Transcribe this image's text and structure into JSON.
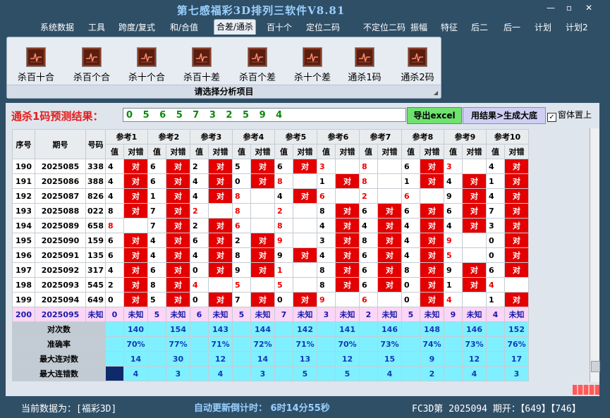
{
  "window": {
    "title": "第七感福彩3D排列三软件V8.81",
    "minimize": "—",
    "maximize": "▫",
    "close": "✕"
  },
  "menu": [
    "系统数据",
    "工具",
    "跨度/复式",
    "和/合值",
    "合差/通杀",
    "百十个",
    "定位二码",
    "不定位二码",
    "振幅",
    "特征",
    "后二",
    "后一",
    "计划",
    "计划2"
  ],
  "menu_active_index": 4,
  "ribbon": {
    "buttons": [
      "杀百十合",
      "杀百个合",
      "杀十个合",
      "杀百十差",
      "杀百个差",
      "杀十个差",
      "通杀1码",
      "通杀2码"
    ],
    "caption": "请选择分析项目",
    "corner": "◢"
  },
  "prediction": {
    "label": "通杀1码预测结果：",
    "value": "0 5 6 5 7 3 2 5 9 4",
    "export_button": "导出excel",
    "generate_button": "用结果>生成大底",
    "topmost_label": "窗体置上",
    "topmost_checked": "✓"
  },
  "table": {
    "fixed_headers": [
      "序号",
      "期号",
      "号码"
    ],
    "ref_labels": [
      "参考1",
      "参考2",
      "参考3",
      "参考4",
      "参考5",
      "参考6",
      "参考7",
      "参考8",
      "参考9",
      "参考10"
    ],
    "sub_value": "值",
    "sub_check": "对错",
    "hit_text": "对",
    "rows": [
      {
        "seq": "190",
        "period": "2025085",
        "num": "338",
        "vals": [
          "4",
          "6",
          "2",
          "5",
          "6",
          "3",
          "8",
          "6",
          "3",
          "4"
        ],
        "red": [
          0,
          0,
          0,
          0,
          0,
          1,
          1,
          0,
          1,
          0
        ],
        "hit": [
          1,
          1,
          1,
          1,
          1,
          0,
          0,
          1,
          0,
          1
        ]
      },
      {
        "seq": "191",
        "period": "2025086",
        "num": "388",
        "vals": [
          "4",
          "6",
          "4",
          "0",
          "8",
          "1",
          "8",
          "1",
          "4",
          "1"
        ],
        "red": [
          0,
          0,
          0,
          0,
          1,
          0,
          1,
          0,
          0,
          0
        ],
        "hit": [
          1,
          1,
          1,
          1,
          0,
          1,
          0,
          1,
          1,
          1
        ]
      },
      {
        "seq": "192",
        "period": "2025087",
        "num": "826",
        "vals": [
          "4",
          "1",
          "4",
          "8",
          "4",
          "6",
          "2",
          "6",
          "9",
          "4"
        ],
        "red": [
          0,
          0,
          0,
          1,
          0,
          1,
          1,
          1,
          0,
          0
        ],
        "hit": [
          1,
          1,
          1,
          0,
          1,
          0,
          0,
          0,
          1,
          1
        ]
      },
      {
        "seq": "193",
        "period": "2025088",
        "num": "022",
        "vals": [
          "8",
          "7",
          "2",
          "8",
          "2",
          "8",
          "6",
          "6",
          "6",
          "7"
        ],
        "red": [
          0,
          0,
          1,
          1,
          1,
          0,
          0,
          0,
          0,
          0
        ],
        "hit": [
          1,
          1,
          0,
          0,
          0,
          1,
          1,
          1,
          1,
          1
        ]
      },
      {
        "seq": "194",
        "period": "2025089",
        "num": "658",
        "vals": [
          "8",
          "7",
          "2",
          "6",
          "8",
          "4",
          "4",
          "4",
          "4",
          "3"
        ],
        "red": [
          1,
          0,
          0,
          1,
          1,
          0,
          0,
          0,
          0,
          0
        ],
        "hit": [
          0,
          1,
          1,
          0,
          0,
          1,
          1,
          1,
          1,
          1
        ]
      },
      {
        "seq": "195",
        "period": "2025090",
        "num": "159",
        "vals": [
          "6",
          "4",
          "6",
          "2",
          "9",
          "3",
          "8",
          "4",
          "9",
          "0"
        ],
        "red": [
          0,
          0,
          0,
          0,
          1,
          0,
          0,
          0,
          1,
          0
        ],
        "hit": [
          1,
          1,
          1,
          1,
          0,
          1,
          1,
          1,
          0,
          1
        ]
      },
      {
        "seq": "196",
        "period": "2025091",
        "num": "135",
        "vals": [
          "6",
          "4",
          "4",
          "8",
          "9",
          "4",
          "6",
          "4",
          "5",
          "0"
        ],
        "red": [
          0,
          0,
          0,
          0,
          0,
          0,
          0,
          0,
          1,
          0
        ],
        "hit": [
          1,
          1,
          1,
          1,
          1,
          1,
          1,
          1,
          0,
          1
        ]
      },
      {
        "seq": "197",
        "period": "2025092",
        "num": "317",
        "vals": [
          "4",
          "6",
          "0",
          "9",
          "1",
          "8",
          "6",
          "8",
          "9",
          "6"
        ],
        "red": [
          0,
          0,
          0,
          0,
          1,
          0,
          0,
          0,
          0,
          0
        ],
        "hit": [
          1,
          1,
          1,
          1,
          0,
          1,
          1,
          1,
          1,
          1
        ]
      },
      {
        "seq": "198",
        "period": "2025093",
        "num": "545",
        "vals": [
          "2",
          "8",
          "4",
          "5",
          "5",
          "8",
          "6",
          "0",
          "1",
          "4"
        ],
        "red": [
          0,
          0,
          1,
          1,
          1,
          0,
          0,
          0,
          0,
          1
        ],
        "hit": [
          1,
          1,
          0,
          0,
          0,
          1,
          1,
          1,
          1,
          0
        ]
      },
      {
        "seq": "199",
        "period": "2025094",
        "num": "649",
        "vals": [
          "0",
          "5",
          "0",
          "7",
          "0",
          "9",
          "6",
          "0",
          "4",
          "1"
        ],
        "red": [
          0,
          0,
          0,
          0,
          0,
          1,
          1,
          0,
          1,
          0
        ],
        "hit": [
          1,
          1,
          1,
          1,
          1,
          0,
          0,
          1,
          0,
          1
        ]
      }
    ],
    "unknown_row": {
      "seq": "200",
      "period": "2025095",
      "num": "未知",
      "vals": [
        "0",
        "5",
        "6",
        "5",
        "7",
        "3",
        "2",
        "5",
        "9",
        "4"
      ],
      "check": "未知"
    },
    "stats": [
      {
        "label": "对次数",
        "values": [
          "140",
          "154",
          "143",
          "144",
          "142",
          "141",
          "146",
          "148",
          "146",
          "152"
        ]
      },
      {
        "label": "准确率",
        "values": [
          "70%",
          "77%",
          "71%",
          "72%",
          "71%",
          "70%",
          "73%",
          "74%",
          "73%",
          "76%"
        ]
      },
      {
        "label": "最大连对数",
        "values": [
          "14",
          "30",
          "12",
          "14",
          "13",
          "12",
          "15",
          "9",
          "12",
          "17"
        ]
      },
      {
        "label": "最大连错数",
        "values": [
          "4",
          "3",
          "4",
          "3",
          "5",
          "5",
          "4",
          "2",
          "4",
          "3"
        ]
      }
    ]
  },
  "status": {
    "current_data": "当前数据为：[福彩3D]",
    "countdown": "自动更新倒计时：  6时14分55秒",
    "lottery": "FC3D第 2025094 期开：【649】【746】"
  }
}
